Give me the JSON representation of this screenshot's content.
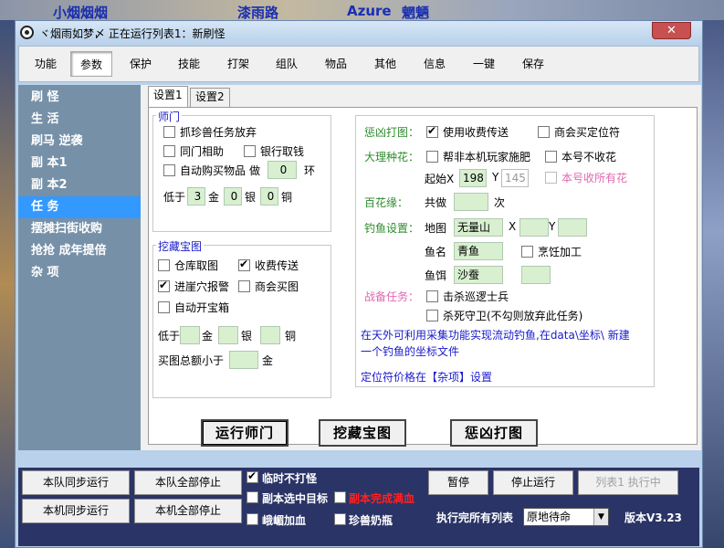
{
  "background": {
    "text1": "小烟烟烟",
    "text2": "漆雨路",
    "text3": "Azure",
    "text4": "魍魉"
  },
  "window": {
    "title": "ヾ烟雨如梦〆  正在运行列表1：新刷怪",
    "close_label": "✕"
  },
  "toolbar": {
    "items": [
      "功能",
      "参数",
      "保护",
      "技能",
      "打架",
      "组队",
      "物品",
      "其他",
      "信息",
      "一键",
      "保存"
    ],
    "active_index": 1
  },
  "sidebar": {
    "items": [
      "刷 怪",
      "生 活",
      "刷马 逆袭",
      "副 本1",
      "副 本2",
      "任 务",
      "摆摊扫街收购",
      "抢抢 成年提倍",
      "杂 项"
    ],
    "active_index": 5
  },
  "tabs": [
    "设置1",
    "设置2"
  ],
  "shimen": {
    "legend": "师门",
    "catch_pet_abandon": "抓珍兽任务放弃",
    "peer_help": "同门相助",
    "bank_withdraw": "银行取钱",
    "auto_buy": "自动购买物品",
    "do_label": "做",
    "do_value": "0",
    "ring_label": "环",
    "below_label": "低于",
    "gold_value": "3",
    "gold_label": "金",
    "silver_value": "0",
    "silver_label": "银",
    "copper_value": "0",
    "copper_label": "铜"
  },
  "treasure": {
    "legend": "挖藏宝图",
    "warehouse_map": "仓库取图",
    "fee_teleport": "收费传送",
    "cave_alert": "进崖穴报警",
    "guild_buy_map": "商会买图",
    "auto_open_box": "自动开宝箱",
    "below_label": "低于",
    "gold_label": "金",
    "silver_label": "银",
    "copper_label": "铜",
    "total_label": "买图总额小于",
    "total_gold_label": "金"
  },
  "right": {
    "chengxiong_label": "惩凶打图：",
    "use_fee_teleport": "使用收费传送",
    "guild_buy_locator": "商会买定位符",
    "dali_label": "大理种花：",
    "help_fertilize": "帮非本机玩家施肥",
    "no_harvest": "本号不收花",
    "start_x_label": "起始X",
    "start_x": "198",
    "y_label": "Y",
    "start_y": "145",
    "collect_all": "本号收所有花",
    "baihua_label": "百花缘：",
    "total_do": "共做",
    "times": "次",
    "fishing_label": "钓鱼设置：",
    "map_label": "地图",
    "map_value": "无量山",
    "x_label": "X",
    "y2_label": "Y",
    "fish_name_label": "鱼名",
    "fish_name": "青鱼",
    "cook_process": "烹饪加工",
    "bait_label": "鱼饵",
    "bait_value": "沙蚕",
    "war_task_label": "战备任务：",
    "kill_patrol": "击杀巡逻士兵",
    "defend_to_death": "杀死守卫(不勾则放弃此任务)",
    "note1": "在天外可利用采集功能实现流动钓鱼,在data\\坐标\\ 新建",
    "note2": "一个钓鱼的坐标文件",
    "note3": "定位符价格在【杂项】设置"
  },
  "actions": {
    "run_shimen": "运行师门",
    "treasure_map": "挖藏宝图",
    "chengxiong": "惩凶打图"
  },
  "bottom": {
    "team_sync_run": "本队同步运行",
    "team_stop_all": "本队全部停止",
    "machine_sync_run": "本机同步运行",
    "machine_stop_all": "本机全部停止",
    "temp_no_fight": "临时不打怪",
    "dungeon_target": "副本选中目标",
    "dungeon_full_blood": "副本完成满血",
    "emei_heal": "峨嵋加血",
    "pet_milk": "珍兽奶瓶",
    "pause": "暂停",
    "stop_run": "停止运行",
    "list1_running": "列表1 执行中",
    "after_all_lists": "执行完所有列表",
    "after_select": "原地待命",
    "version": "版本V3.23"
  }
}
